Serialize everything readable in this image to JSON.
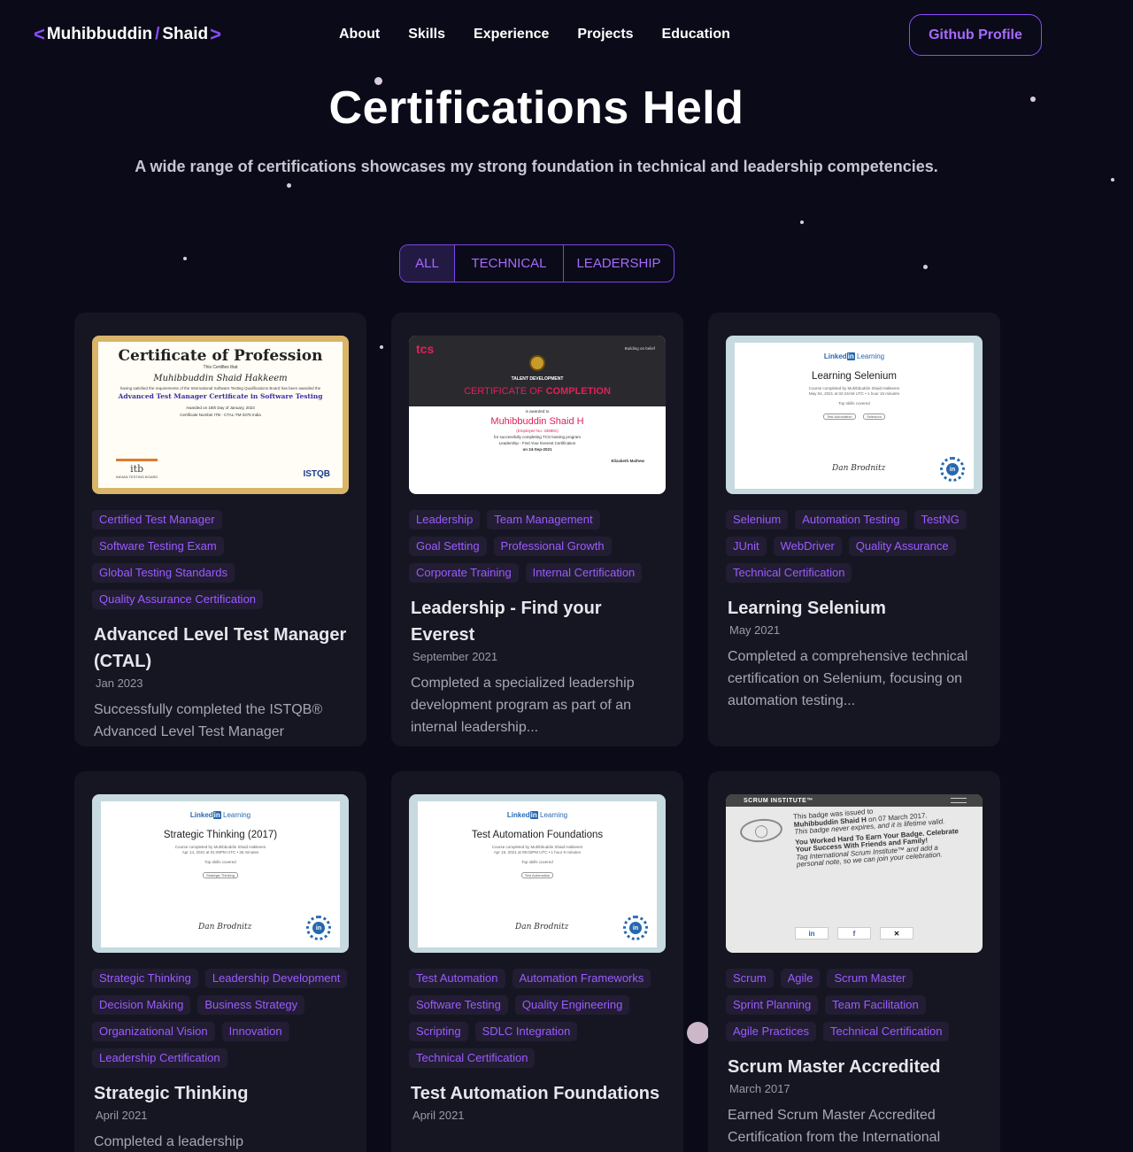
{
  "nav": {
    "logo_left_chevron": "<",
    "logo_first": "Muhibbuddin",
    "logo_slash": "/",
    "logo_last": "Shaid",
    "logo_right_chevron": ">",
    "links": [
      "About",
      "Skills",
      "Experience",
      "Projects",
      "Education"
    ],
    "github_button": "Github Profile"
  },
  "heading": {
    "title": "Certifications Held",
    "subtitle": "A wide range of certifications showcases my strong foundation in technical and leadership competencies."
  },
  "filters": {
    "tabs": [
      "ALL",
      "TECHNICAL",
      "LEADERSHIP"
    ],
    "active": "ALL"
  },
  "colors": {
    "background": "#0b0a18",
    "card": "#161622",
    "accent": "#8a4dff",
    "tag_text": "#9b5cff",
    "tag_bg": "#221d33"
  },
  "cards": [
    {
      "title": "Advanced Level Test Manager (CTAL)",
      "date": "Jan 2023",
      "description": "Successfully completed the ISTQB® Advanced Level Test Manager",
      "tags": [
        "Certified Test Manager",
        "Software Testing Exam",
        "Global Testing Standards",
        "Quality Assurance Certification"
      ],
      "thumb": {
        "heading": "Certificate of Profession",
        "certifies": "This Certifies that",
        "name": "Muhibbuddin Shaid Hakkeem",
        "having": "having satisfied the requirements of the International Software Testing Qualifications Board has been awarded the",
        "course": "Advanced Test Manager Certificate in Software Testing",
        "awarded": "Awarded on   18th Day of January, 2023",
        "number": "Certificate Number ITB -    CTAL-TM-3375 India",
        "left_logo": "itb",
        "left_logo_sub": "INDIAN TESTING BOARD",
        "right_logo": "ISTQB"
      }
    },
    {
      "title": "Leadership - Find your Everest",
      "date": "September 2021",
      "description": "Completed a specialized leadership development program as part of an internal leadership...",
      "tags": [
        "Leadership",
        "Team Management",
        "Goal Setting",
        "Professional Growth",
        "Corporate Training",
        "Internal Certification"
      ],
      "thumb": {
        "brand": "tcs",
        "belief": "Building on belief",
        "dept": "TALENT DEVELOPMENT",
        "heading_a": "CERTIFICATE OF ",
        "heading_b": "COMPLETION",
        "awarded": "is awarded to",
        "name": "Muhibbuddin Shaid H",
        "emp": "(Employee No: 338881)",
        "line1": "for successfully completing TCS training program",
        "line2": "Leadership - Find Your Everest Certification",
        "date": "on 24-Sep-2021",
        "signer": "Elizabeth Mathew"
      }
    },
    {
      "title": "Learning Selenium",
      "date": "May 2021",
      "description": "Completed a comprehensive technical certification on Selenium, focusing on automation testing...",
      "tags": [
        "Selenium",
        "Automation Testing",
        "TestNG",
        "JUnit",
        "WebDriver",
        "Quality Assurance",
        "Technical Certification"
      ],
      "thumb": {
        "brand_a": "Linked",
        "brand_b": "in",
        "brand_c": " Learning",
        "course": "Learning Selenium",
        "completed": "Course completed by Muhibbuddin Shaid Hakkeem",
        "when": "May 04, 2021 at 02:44AM UTC • 1 hour 15 minutes",
        "skills_label": "Top skills covered",
        "skills": [
          "Test Automation",
          "Selenium"
        ],
        "signature": "Dan Brodnitz",
        "badge": "in"
      }
    },
    {
      "title": "Strategic Thinking",
      "date": "April 2021",
      "description": "Completed a leadership",
      "tags": [
        "Strategic Thinking",
        "Leadership Development",
        "Decision Making",
        "Business Strategy",
        "Organizational Vision",
        "Innovation",
        "Leadership Certification"
      ],
      "thumb": {
        "brand_a": "Linked",
        "brand_b": "in",
        "brand_c": " Learning",
        "course": "Strategic Thinking (2017)",
        "completed": "Course completed by Muhibbuddin Shaid Hakkeem",
        "when": "Apr 14, 2021 at 01:00PM UTC • 36 minutes",
        "skills_label": "Top skills covered",
        "skills": [
          "Strategic Thinking"
        ],
        "signature": "Dan Brodnitz",
        "badge": "in"
      }
    },
    {
      "title": "Test Automation Foundations",
      "date": "April 2021",
      "description": "",
      "tags": [
        "Test Automation",
        "Automation Frameworks",
        "Software Testing",
        "Quality Engineering",
        "Scripting",
        "SDLC Integration",
        "Technical Certification"
      ],
      "thumb": {
        "brand_a": "Linked",
        "brand_b": "in",
        "brand_c": " Learning",
        "course": "Test Automation Foundations",
        "completed": "Course completed by Muhibbuddin Shaid Hakkeem",
        "when": "Apr 16, 2021 at 09:02PM UTC • 1 hour 9 minutes",
        "skills_label": "Top skills covered",
        "skills": [
          "Test Automation"
        ],
        "signature": "Dan Brodnitz",
        "badge": "in"
      }
    },
    {
      "title": "Scrum Master Accredited",
      "date": "March 2017",
      "description": "Earned Scrum Master Accredited Certification from the International",
      "tags": [
        "Scrum",
        "Agile",
        "Scrum Master",
        "Sprint Planning",
        "Team Facilitation",
        "Agile Practices",
        "Technical Certification"
      ],
      "thumb": {
        "bar": "SCRUM INSTITUTE™",
        "l1": "This badge was issued to",
        "l2": "Muhibbuddin Shaid H",
        "l2b": " on 07 March 2017.",
        "l3": "This badge never expires, and it is lifetime valid.",
        "l4": "You Worked Hard To Earn Your Badge. Celebrate Your Success With Friends and Family!",
        "l5": "Tag International Scrum Institute™ and add a personal note, so we can join your celebration.",
        "share": [
          "in",
          "f",
          "✕"
        ]
      }
    }
  ]
}
